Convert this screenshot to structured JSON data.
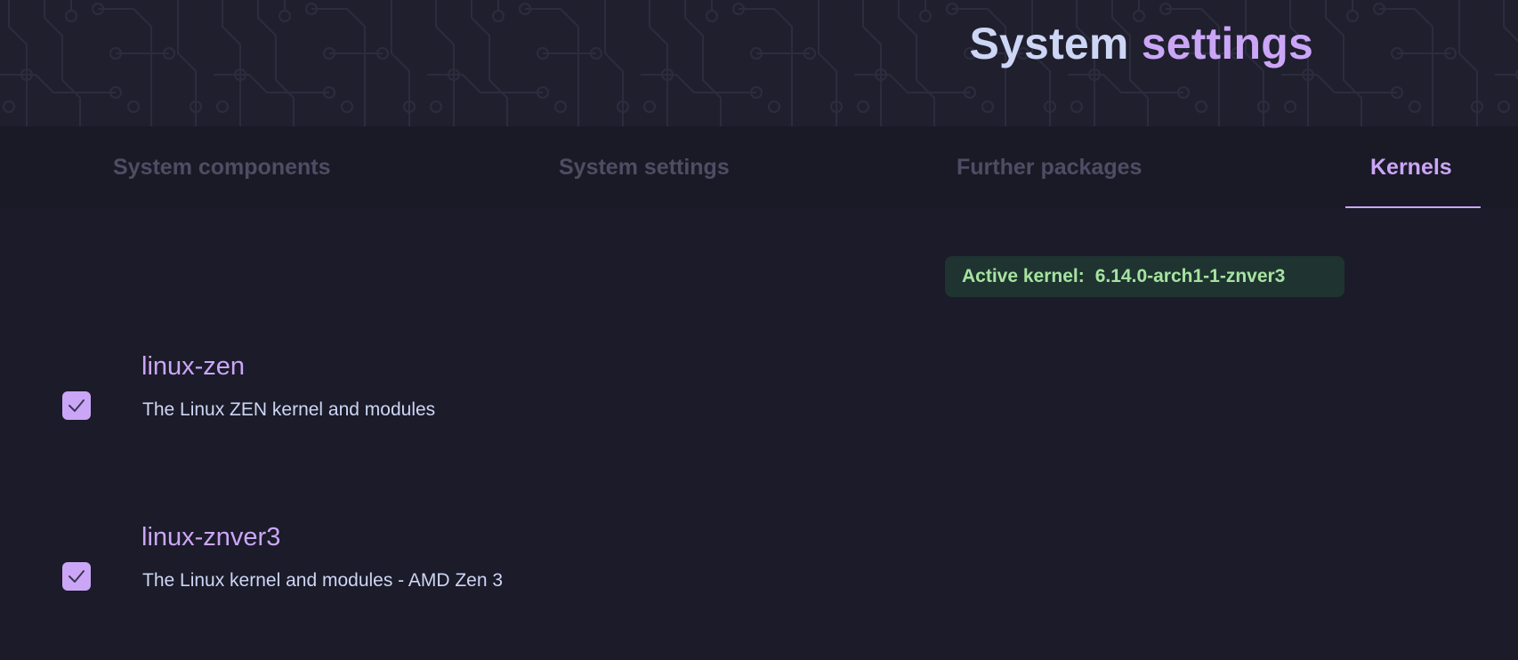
{
  "header": {
    "title_part1": "System",
    "title_part2": "settings"
  },
  "tabs": [
    {
      "label": "System components",
      "active": false
    },
    {
      "label": "System settings",
      "active": false
    },
    {
      "label": "Further packages",
      "active": false
    },
    {
      "label": "Kernels",
      "active": true
    }
  ],
  "active_kernel": {
    "label": "Active kernel:",
    "value": "6.14.0-arch1-1-znver3"
  },
  "kernels": [
    {
      "name": "linux-zen",
      "description": "The Linux ZEN kernel and modules",
      "checked": true
    },
    {
      "name": "linux-znver3",
      "description": "The Linux kernel and modules - AMD Zen 3",
      "checked": true
    }
  ],
  "colors": {
    "accent": "#cba6f7",
    "text": "#cdd6f4",
    "tab_inactive": "#4d4d63",
    "badge_bg": "#1f3430",
    "badge_text": "#a6e3a1",
    "background": "#1b1b29"
  }
}
